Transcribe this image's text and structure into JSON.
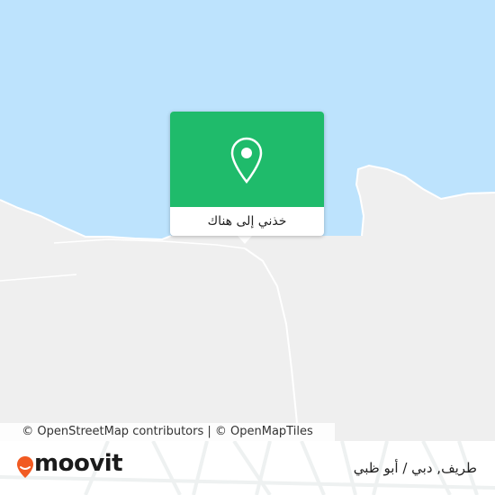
{
  "map": {
    "colors": {
      "water": "#bde3fd",
      "land": "#efefef",
      "road": "#ffffff",
      "popup_accent": "#1fbb6b",
      "logo_accent": "#f15a22"
    }
  },
  "popup": {
    "label": "خذني إلى هناك",
    "icon": "location-pin-icon"
  },
  "attribution": {
    "text": "© OpenStreetMap contributors | © OpenMapTiles"
  },
  "footer": {
    "logo_text": "moovit",
    "logo_icon": "moovit-pin-icon",
    "place_name": "طريف, دبي / أبو ظبي"
  }
}
